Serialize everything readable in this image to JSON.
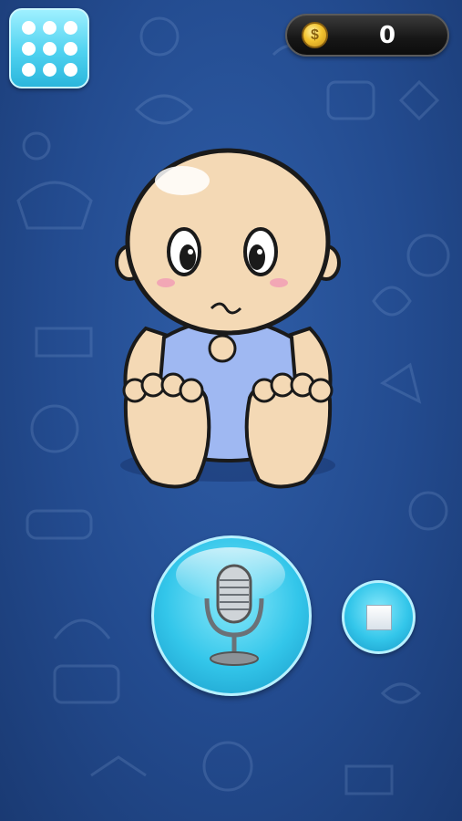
{
  "hud": {
    "coins": "0",
    "coin_symbol": "$",
    "accent_color": "#33c6ea",
    "icons": {
      "menu": "grid-dots-icon",
      "coin": "coin-icon",
      "record": "microphone-icon",
      "stop": "stop-icon"
    }
  },
  "scene": {
    "character": "baby",
    "background_color": "#234b8f"
  }
}
